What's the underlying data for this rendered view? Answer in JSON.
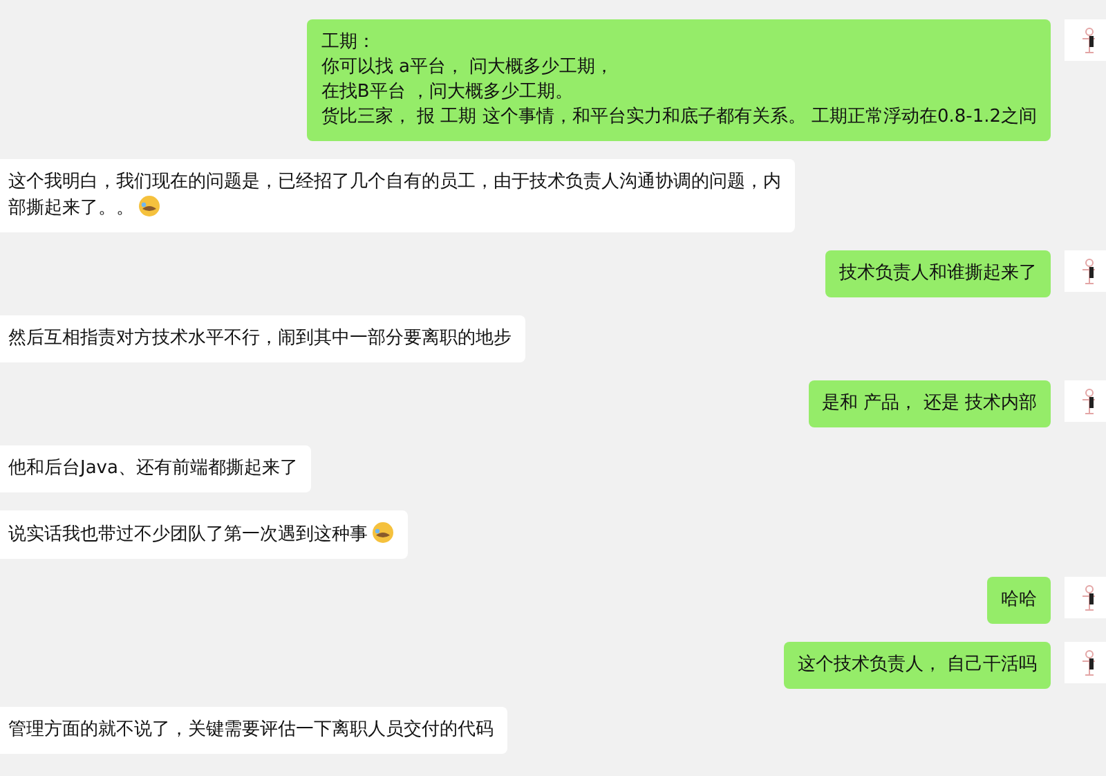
{
  "messages": [
    {
      "kind": "sent",
      "lines": [
        "工期：",
        "你可以找 a平台， 问大概多少工期，",
        "在找B平台 ，问大概多少工期。",
        "货比三家， 报 工期 这个事情，和平台实力和底子都有关系。 工期正常浮动在0.8-1.2之间"
      ],
      "emoji": false
    },
    {
      "kind": "received",
      "lines": [
        "这个我明白，我们现在的问题是，已经招了几个自有的员工，由于技术负责人沟通协调的问题，内",
        "部撕起来了。。"
      ],
      "emoji": true
    },
    {
      "kind": "sent",
      "lines": [
        "技术负责人和谁撕起来了"
      ],
      "emoji": false
    },
    {
      "kind": "received",
      "lines": [
        "然后互相指责对方技术水平不行，闹到其中一部分要离职的地步"
      ],
      "emoji": false
    },
    {
      "kind": "sent",
      "lines": [
        "是和 产品， 还是 技术内部"
      ],
      "emoji": false
    },
    {
      "kind": "received",
      "lines": [
        "他和后台Java、还有前端都撕起来了"
      ],
      "emoji": false
    },
    {
      "kind": "received",
      "lines": [
        "说实话我也带过不少团队了第一次遇到这种事"
      ],
      "emoji": true
    },
    {
      "kind": "sent",
      "lines": [
        "哈哈"
      ],
      "emoji": false
    },
    {
      "kind": "sent",
      "lines": [
        "这个技术负责人， 自己干活吗"
      ],
      "emoji": false
    },
    {
      "kind": "received",
      "lines": [
        "管理方面的就不说了，关键需要评估一下离职人员交付的代码"
      ],
      "emoji": false
    }
  ]
}
